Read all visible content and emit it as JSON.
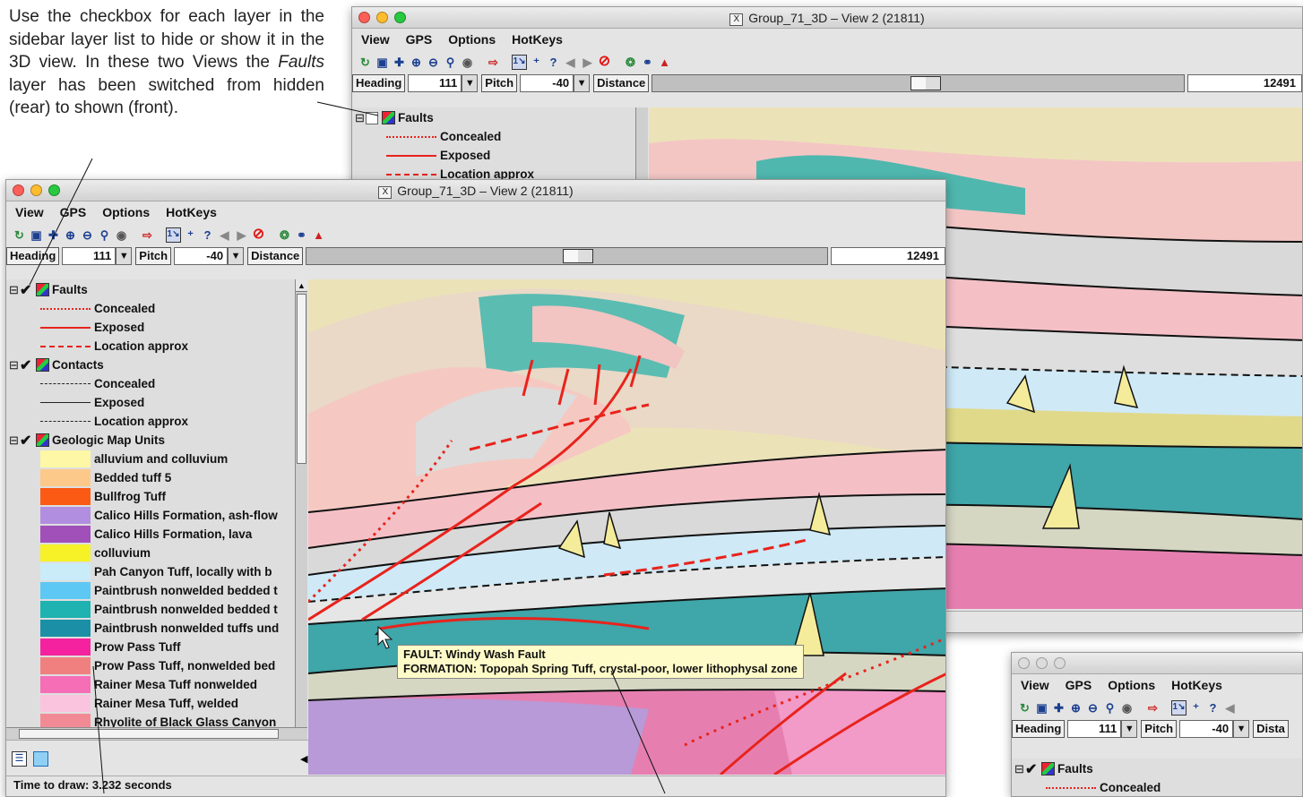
{
  "note": {
    "text_before": "Use the checkbox for each layer in the sidebar layer list to hide or show it in the 3D view. In these two Views the ",
    "emphasis": "Faults",
    "text_after": " layer has been switched from hidden (rear) to shown (front)."
  },
  "window": {
    "title": "Group_71_3D – View 2 (21811)",
    "menu": [
      "View",
      "GPS",
      "Options",
      "HotKeys"
    ],
    "viewbar": {
      "heading_label": "Heading",
      "heading_value": "111",
      "pitch_label": "Pitch",
      "pitch_value": "-40",
      "distance_label": "Distance",
      "distance_short": "Dista",
      "distance_value": "12491"
    },
    "status": "Time to draw: 3.232 seconds"
  },
  "legend": {
    "faults": {
      "title": "Faults",
      "items": [
        {
          "label": "Concealed",
          "style": "dotted",
          "color": "#e8231c"
        },
        {
          "label": "Exposed",
          "style": "solid",
          "color": "#e8231c"
        },
        {
          "label": "Location approx",
          "style": "dashed",
          "color": "#e8231c"
        }
      ]
    },
    "contacts": {
      "title": "Contacts",
      "items": [
        {
          "label": "Concealed",
          "style": "dashed",
          "color": "#222222"
        },
        {
          "label": "Exposed",
          "style": "solid",
          "color": "#222222"
        },
        {
          "label": "Location approx",
          "style": "dashed",
          "color": "#222222"
        }
      ]
    },
    "units": {
      "title": "Geologic Map Units",
      "items": [
        {
          "label": "alluvium and colluvium",
          "color": "#fdf7a6"
        },
        {
          "label": "Bedded tuff 5",
          "color": "#fcc98a"
        },
        {
          "label": "Bullfrog Tuff",
          "color": "#fb5a14"
        },
        {
          "label": "Calico Hills Formation, ash-flow",
          "color": "#b28ee0"
        },
        {
          "label": "Calico Hills Formation, lava",
          "color": "#a050b8"
        },
        {
          "label": "colluvium",
          "color": "#f6f227"
        },
        {
          "label": "Pah Canyon Tuff, locally with b",
          "color": "#c9ecf8"
        },
        {
          "label": "Paintbrush nonwelded bedded t",
          "color": "#5ec8f4"
        },
        {
          "label": "Paintbrush nonwelded bedded t",
          "color": "#1eb2b0"
        },
        {
          "label": "Paintbrush nonwelded tuffs und",
          "color": "#1a8fa6"
        },
        {
          "label": "Prow Pass Tuff",
          "color": "#f4229e"
        },
        {
          "label": "Prow Pass Tuff, nonwelded bed",
          "color": "#f08080"
        },
        {
          "label": "Rainer Mesa Tuff nonwelded",
          "color": "#f56eb6"
        },
        {
          "label": "Rainer Mesa Tuff, welded",
          "color": "#fbc4de"
        },
        {
          "label": "Rhyolite of Black Glass Canyon",
          "color": "#f28a96"
        }
      ]
    }
  },
  "tooltip": {
    "line1": "FAULT: Windy Wash Fault",
    "line2": "FORMATION: Topopah Spring Tuff, crystal-poor, lower lithophysal zone"
  },
  "colors": {
    "faults": "#e8231c",
    "contacts": "#222222",
    "tooltip_bg": "#fffbc8"
  },
  "icons": [
    "reset-view-icon",
    "fit-view-icon",
    "pan-icon",
    "zoom-in-icon",
    "zoom-out-icon",
    "zoom-select-icon",
    "snapshot-icon",
    "import-icon",
    "selection-icon",
    "add-point-icon",
    "help-pointer-icon",
    "back-arrow-icon",
    "forward-arrow-icon",
    "stop-icon",
    "gps-icon",
    "globe-icon",
    "navigator-icon"
  ]
}
